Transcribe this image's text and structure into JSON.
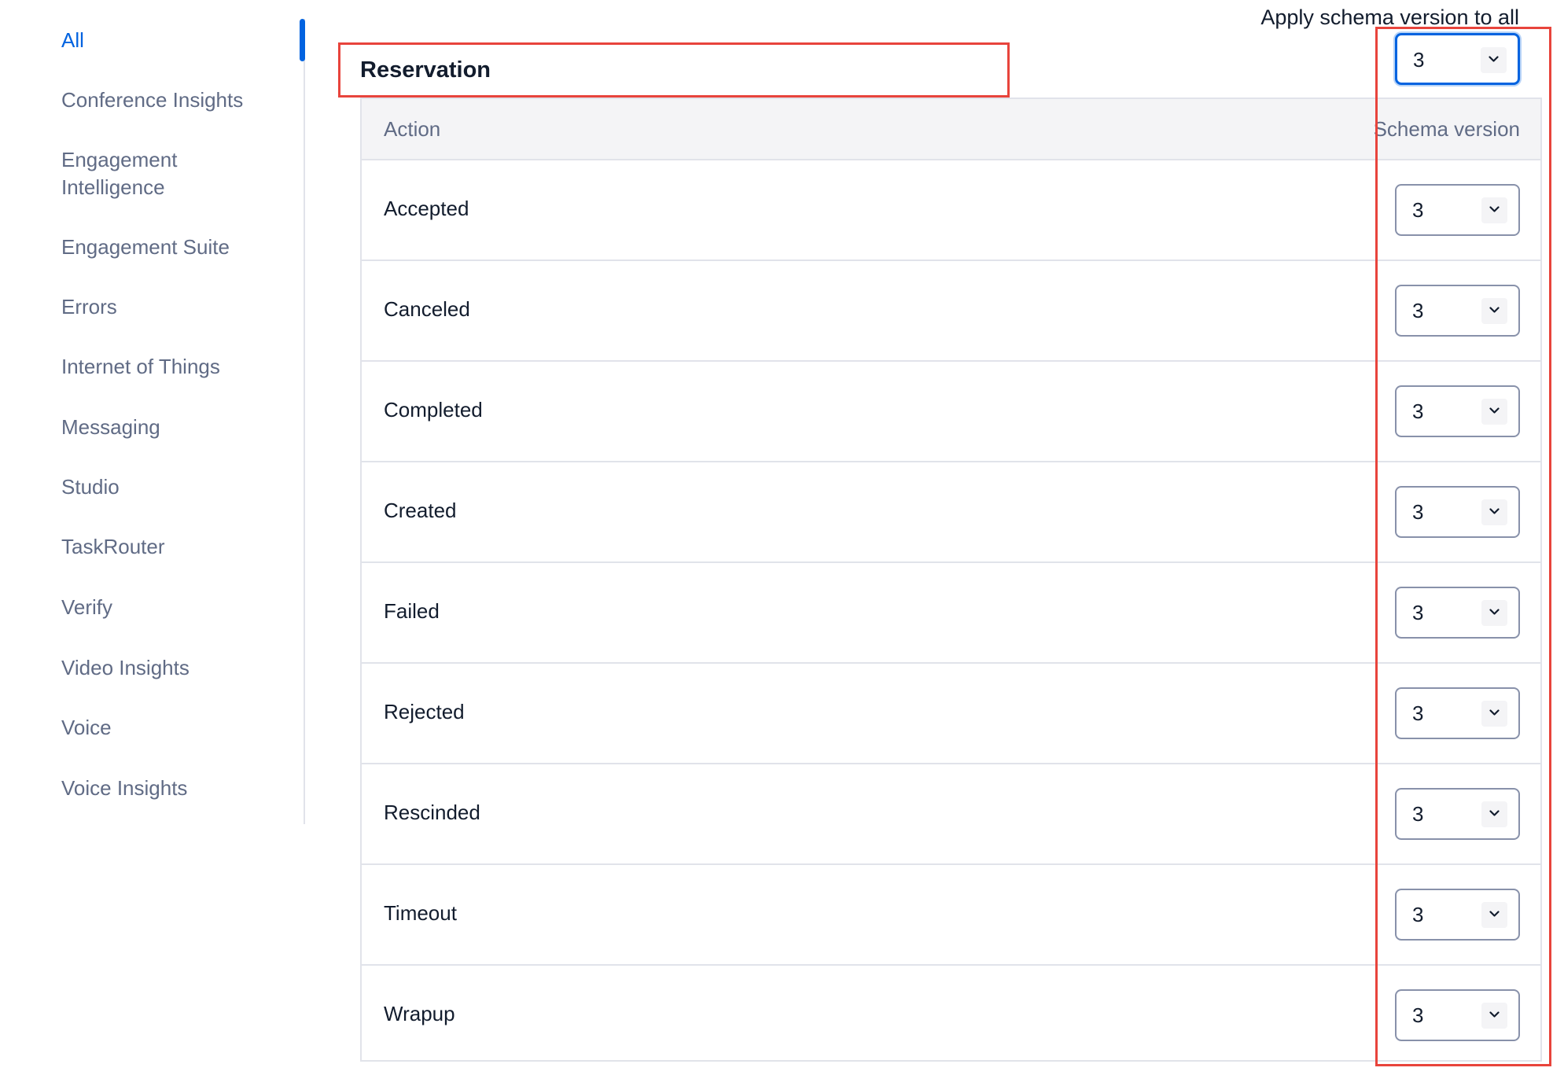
{
  "sidebar": {
    "items": [
      {
        "label": "All",
        "active": true
      },
      {
        "label": "Conference Insights",
        "active": false
      },
      {
        "label": "Engagement Intelligence",
        "active": false
      },
      {
        "label": "Engagement Suite",
        "active": false
      },
      {
        "label": "Errors",
        "active": false
      },
      {
        "label": "Internet of Things",
        "active": false
      },
      {
        "label": "Messaging",
        "active": false
      },
      {
        "label": "Studio",
        "active": false
      },
      {
        "label": "TaskRouter",
        "active": false
      },
      {
        "label": "Verify",
        "active": false
      },
      {
        "label": "Video Insights",
        "active": false
      },
      {
        "label": "Voice",
        "active": false
      },
      {
        "label": "Voice Insights",
        "active": false
      }
    ]
  },
  "section": {
    "title": "Reservation"
  },
  "apply_all": {
    "label": "Apply schema version to all",
    "value": "3"
  },
  "table": {
    "headers": {
      "action": "Action",
      "schema_version": "Schema version"
    },
    "rows": [
      {
        "action": "Accepted",
        "version": "3"
      },
      {
        "action": "Canceled",
        "version": "3"
      },
      {
        "action": "Completed",
        "version": "3"
      },
      {
        "action": "Created",
        "version": "3"
      },
      {
        "action": "Failed",
        "version": "3"
      },
      {
        "action": "Rejected",
        "version": "3"
      },
      {
        "action": "Rescinded",
        "version": "3"
      },
      {
        "action": "Timeout",
        "version": "3"
      },
      {
        "action": "Wrapup",
        "version": "3"
      }
    ]
  },
  "colors": {
    "accent": "#0263e0",
    "highlight": "#e8443c",
    "muted_text": "#606b85",
    "text": "#121c2d",
    "border": "#e1e3ea",
    "header_bg": "#f4f4f6"
  },
  "icons": {
    "select_chevron": "chevron-down-icon"
  }
}
